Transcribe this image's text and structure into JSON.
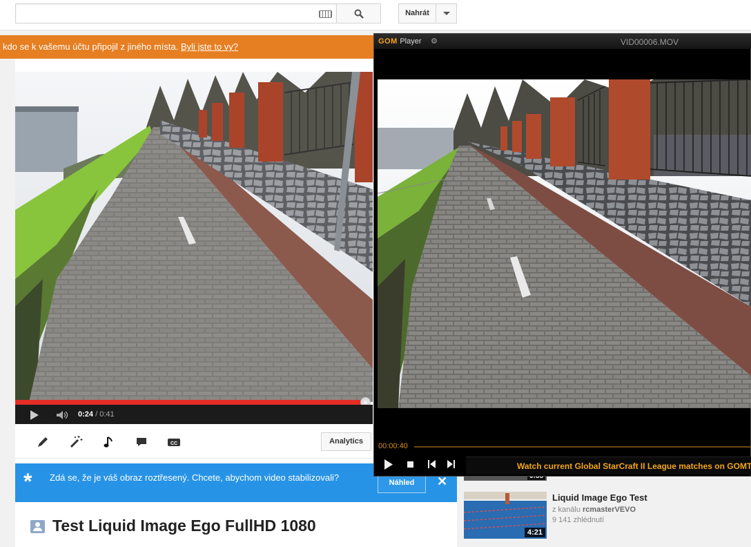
{
  "header": {
    "search_placeholder": "",
    "upload_label": "Nahrát"
  },
  "alert": {
    "text": "kdo se k vašemu účtu připojil z jiného místa. ",
    "link": "Byli jste to vy?",
    "color": "#e67e22"
  },
  "player": {
    "current_time": "0:24",
    "separator": " / ",
    "duration": "0:41",
    "progress_fraction": 0.98,
    "accent": "#e52d27"
  },
  "tools": {
    "icons": [
      "pencil-icon",
      "magic-wand-icon",
      "music-note-icon",
      "speech-bubble-icon",
      "cc-icon"
    ],
    "analytics_label": "Analytics"
  },
  "stabilize": {
    "text": "Zdá se, že je váš obraz roztřesený. Chcete, abychom video stabilizovali?",
    "preview_label": "Náhled",
    "color": "#2793e6"
  },
  "video": {
    "title": "Test Liquid Image Ego FullHD 1080"
  },
  "related": {
    "peek_duration": "0:58",
    "items": [
      {
        "title": "Liquid Image Ego Test",
        "channel_prefix": "z kanálu ",
        "channel": "rcmasterVEVO",
        "views": "9 141 zhlédnutí",
        "duration": "4:21"
      }
    ]
  },
  "gom": {
    "logo": "GOM",
    "logo_suffix": "Player",
    "filename": "VID00006.MOV",
    "time": "00:00:40",
    "ticker": "Watch current Global StarCraft II League matches on GOMTV",
    "accent": "#f7a21b"
  }
}
